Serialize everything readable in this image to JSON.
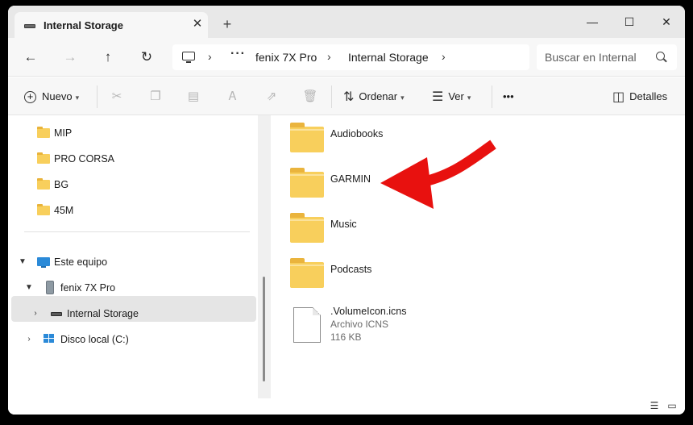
{
  "tab": {
    "title": "Internal Storage",
    "close": "✕",
    "new_tab": "+"
  },
  "window_controls": {
    "minimize": "—",
    "maximize": "☐",
    "close": "✕"
  },
  "nav": {
    "back": "←",
    "forward": "→",
    "up": "↑",
    "refresh": "↻"
  },
  "address": {
    "more": "···",
    "crumbs": [
      "fenix 7X Pro",
      "Internal Storage"
    ],
    "sep": "›"
  },
  "search": {
    "placeholder": "Buscar en Internal"
  },
  "commands": {
    "new_label": "Nuevo",
    "sort_label": "Ordenar",
    "view_label": "Ver",
    "more": "•••",
    "details_label": "Detalles"
  },
  "sidebar": {
    "quick_folders": [
      "MIP",
      "PRO CORSA",
      "BG",
      "45M"
    ],
    "this_pc": "Este equipo",
    "device": "fenix 7X Pro",
    "storage": "Internal Storage",
    "local_disk": "Disco local (C:)"
  },
  "files": [
    {
      "name": "Audiobooks",
      "kind": "folder"
    },
    {
      "name": "GARMIN",
      "kind": "folder"
    },
    {
      "name": "Music",
      "kind": "folder"
    },
    {
      "name": "Podcasts",
      "kind": "folder"
    },
    {
      "name": ".VolumeIcon.icns",
      "kind": "file",
      "type": "Archivo ICNS",
      "size": "116 KB"
    }
  ],
  "colors": {
    "folder": "#f8cf5c",
    "arrow": "#e8110f",
    "accent": "#2b8ad8"
  }
}
